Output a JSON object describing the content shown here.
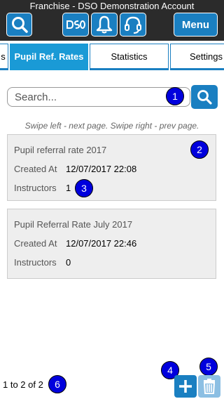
{
  "header": {
    "title": "Franchise - DSO Demonstration Account",
    "menu_label": "Menu",
    "logo_text": "DSO"
  },
  "tabs": [
    {
      "label": "s"
    },
    {
      "label": "Pupil Ref. Rates"
    },
    {
      "label": "Statistics"
    },
    {
      "label": "Settings"
    }
  ],
  "search": {
    "placeholder": "Search...",
    "value": ""
  },
  "hint": "Swipe left - next page. Swipe right - prev page.",
  "records": [
    {
      "title": "Pupil referral rate 2017",
      "created_label": "Created At",
      "created_value": "12/07/2017 22:08",
      "instructors_label": "Instructors",
      "instructors_value": "1"
    },
    {
      "title": "Pupil Referral Rate July 2017",
      "created_label": "Created At",
      "created_value": "12/07/2017 22:46",
      "instructors_label": "Instructors",
      "instructors_value": "0"
    }
  ],
  "markers": [
    "1",
    "2",
    "3",
    "4",
    "5",
    "6"
  ],
  "paging": "1 to 2 of 2",
  "colors": {
    "header_bg": "#2b2b2b",
    "accent": "#1a7fc1",
    "active_tab": "#1a9ad6",
    "marker": "#0000dd"
  },
  "icons": [
    "search-icon",
    "dso-logo-icon",
    "bell-icon",
    "headset-icon",
    "plus-icon",
    "trash-icon"
  ]
}
